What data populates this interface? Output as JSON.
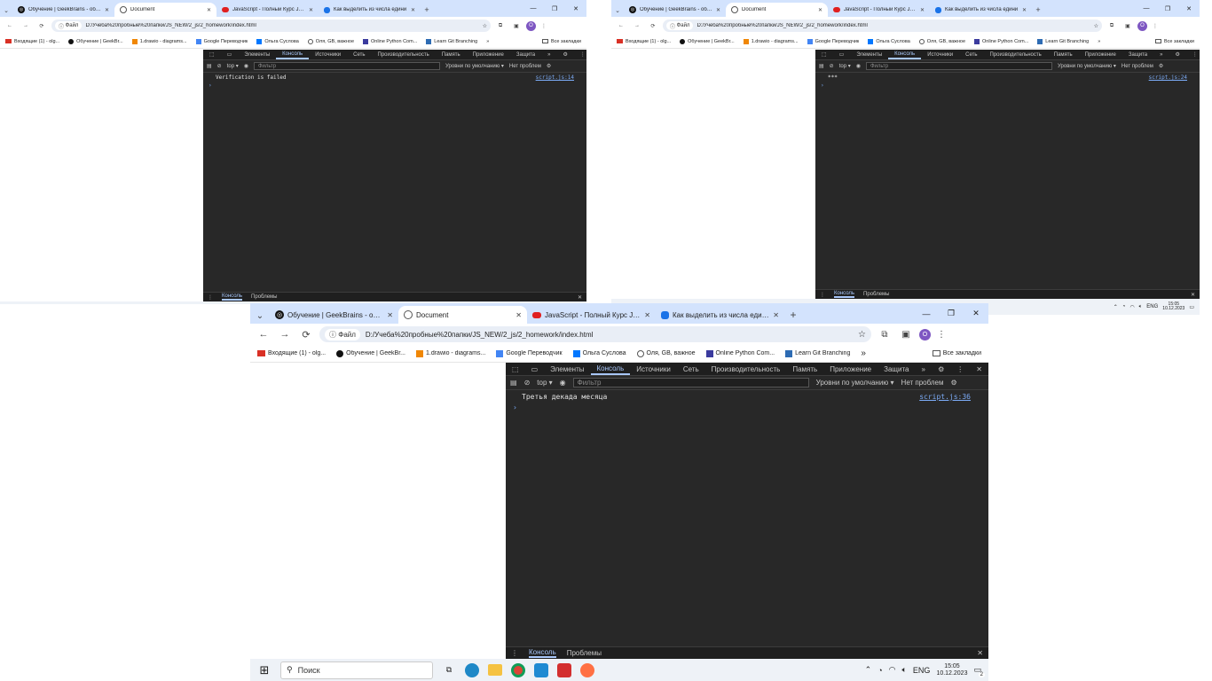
{
  "browser": {
    "tabs": [
      {
        "title": "Обучение | GeekBrains - образ",
        "icon": "geekbrains-icon"
      },
      {
        "title": "Document",
        "icon": "document-icon"
      },
      {
        "title": "JavaScript - Полный Курс Javas",
        "icon": "youtube-icon"
      },
      {
        "title": "Как выделить из числа едини",
        "icon": "page-icon"
      }
    ],
    "new_tab_label": "+",
    "url_chip": "Файл",
    "url": "D:/Учеба%20пробные%20папки/JS_NEW/2_js/2_homework/index.html",
    "profile_initial": "O",
    "bookmarks": [
      {
        "label": "Входящие (1) - olg...",
        "icon": "gmail-icon"
      },
      {
        "label": "Обучение | GeekBr...",
        "icon": "geekbrains-icon"
      },
      {
        "label": "1.drawio - diagrams...",
        "icon": "drawio-icon"
      },
      {
        "label": "Google Переводчик",
        "icon": "translate-icon"
      },
      {
        "label": "Ольга Суслова",
        "icon": "vk-icon"
      },
      {
        "label": "Оля, GB, важное",
        "icon": "link-icon"
      },
      {
        "label": "Online Python Com...",
        "icon": "python-icon"
      },
      {
        "label": "Learn Git Branching",
        "icon": "git-icon"
      }
    ],
    "more_bookmarks": "»",
    "all_bookmarks": "Все закладки"
  },
  "devtools": {
    "tabs": [
      "Элементы",
      "Консоль",
      "Источники",
      "Сеть",
      "Производительность",
      "Память",
      "Приложение",
      "Защита"
    ],
    "more_tabs": "»",
    "context": "top",
    "filter_placeholder": "Фильтр",
    "levels": "Уровни по умолчанию",
    "issues": "Нет проблем",
    "prompt": "›",
    "drawer_tabs": [
      "Консоль",
      "Проблемы"
    ],
    "close": "✕"
  },
  "windows": {
    "left": {
      "message": "Verification is failed",
      "source": "script.js:14"
    },
    "right": {
      "message": "***",
      "source": "script.js:24"
    },
    "main": {
      "message": "Третья декада месяца",
      "source": "script.js:36"
    }
  },
  "taskbar": {
    "search_label": "Поиск",
    "lang": "ENG",
    "time": "15:05",
    "date": "10.12.2023",
    "notification_count": "2"
  },
  "colors": {
    "tabstrip": "#d3e3fd",
    "devtools_bg": "#282828",
    "devtools_accent": "#a8c7fa",
    "link": "#7cacf8"
  }
}
